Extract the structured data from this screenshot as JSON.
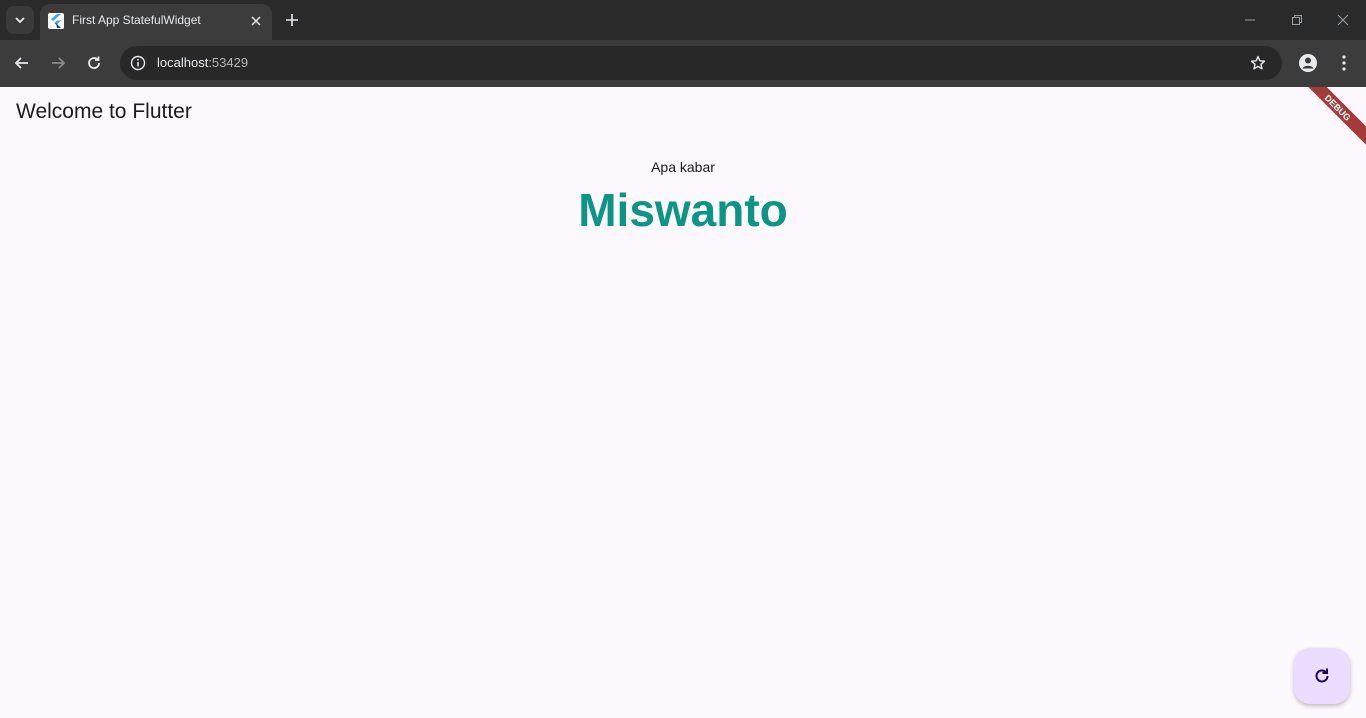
{
  "browser": {
    "tab": {
      "title": "First App StatefulWidget",
      "favicon": "flutter-logo-icon"
    },
    "address_bar": {
      "host": "localhost",
      "port": ":53429"
    },
    "icons": {
      "tab_search": "chevron-down-icon",
      "tab_close": "close-icon",
      "new_tab": "plus-icon",
      "back": "arrow-left-icon",
      "forward": "arrow-right-icon",
      "reload": "reload-icon",
      "site_info": "info-icon",
      "bookmark": "star-icon",
      "profile": "person-icon",
      "menu": "more-vertical-icon",
      "minimize": "minimize-icon",
      "restore": "restore-icon",
      "close_window": "close-icon"
    }
  },
  "app": {
    "title": "Welcome to Flutter",
    "greeting": "Apa kabar",
    "name": "Miswanto",
    "debug_banner": "DEBUG",
    "fab_icon": "refresh-icon",
    "colors": {
      "name": "#0d9488",
      "background": "#fdf8fd",
      "fab": "#ebddff",
      "debug_banner": "#a33b3b"
    }
  }
}
